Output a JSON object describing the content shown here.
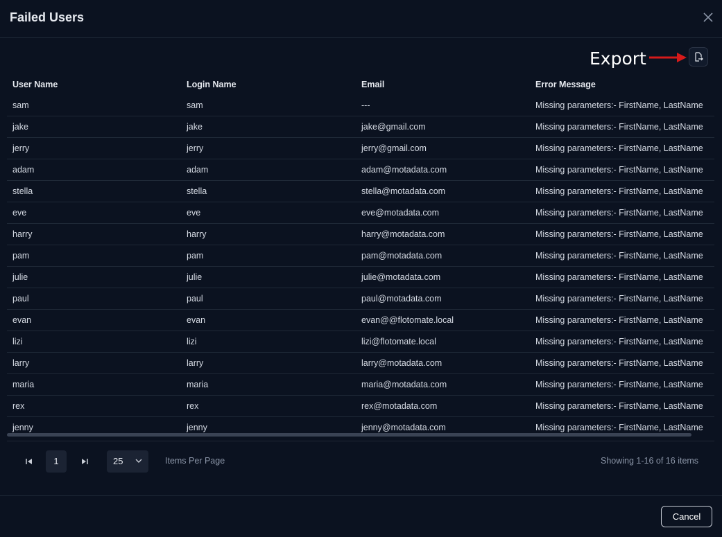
{
  "modal": {
    "title": "Failed Users"
  },
  "annotation": {
    "export_label": "Export",
    "arrow_color": "#d61a1a"
  },
  "export_button": {
    "icon": "file-export-icon"
  },
  "table": {
    "headers": [
      "User Name",
      "Login Name",
      "Email",
      "Error Message"
    ],
    "rows": [
      [
        "sam",
        "sam",
        "---",
        "Missing parameters:- FirstName, LastName"
      ],
      [
        "jake",
        "jake",
        "jake@gmail.com",
        "Missing parameters:- FirstName, LastName"
      ],
      [
        "jerry",
        "jerry",
        "jerry@gmail.com",
        "Missing parameters:- FirstName, LastName"
      ],
      [
        "adam",
        "adam",
        "adam@motadata.com",
        "Missing parameters:- FirstName, LastName"
      ],
      [
        "stella",
        "stella",
        "stella@motadata.com",
        "Missing parameters:- FirstName, LastName"
      ],
      [
        "eve",
        "eve",
        "eve@motadata.com",
        "Missing parameters:- FirstName, LastName"
      ],
      [
        "harry",
        "harry",
        "harry@motadata.com",
        "Missing parameters:- FirstName, LastName"
      ],
      [
        "pam",
        "pam",
        "pam@motadata.com",
        "Missing parameters:- FirstName, LastName"
      ],
      [
        "julie",
        "julie",
        "julie@motadata.com",
        "Missing parameters:- FirstName, LastName"
      ],
      [
        "paul",
        "paul",
        "paul@motadata.com",
        "Missing parameters:- FirstName, LastName"
      ],
      [
        "evan",
        "evan",
        "evan@@flotomate.local",
        "Missing parameters:- FirstName, LastName"
      ],
      [
        "lizi",
        "lizi",
        "lizi@flotomate.local",
        "Missing parameters:- FirstName, LastName"
      ],
      [
        "larry",
        "larry",
        "larry@motadata.com",
        "Missing parameters:- FirstName, LastName"
      ],
      [
        "maria",
        "maria",
        "maria@motadata.com",
        "Missing parameters:- FirstName, LastName"
      ],
      [
        "rex",
        "rex",
        "rex@motadata.com",
        "Missing parameters:- FirstName, LastName"
      ],
      [
        "jenny",
        "jenny",
        "jenny@motadata.com",
        "Missing parameters:- FirstName, LastName"
      ]
    ]
  },
  "pagination": {
    "current_page": "1",
    "page_size": "25",
    "items_per_page_label": "Items Per Page",
    "showing_text": "Showing 1-16 of 16 items"
  },
  "footer": {
    "cancel_label": "Cancel"
  }
}
